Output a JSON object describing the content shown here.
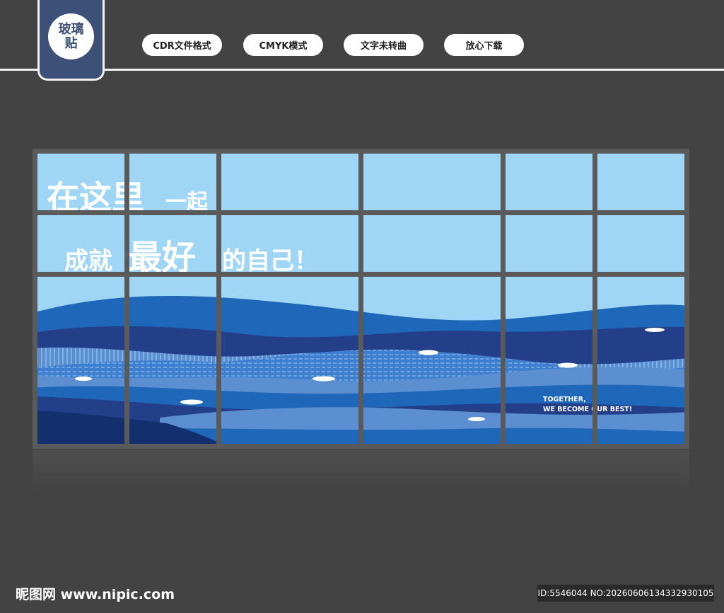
{
  "header": {
    "tag_label": "玻璃贴",
    "pills": [
      "CDR文件格式",
      "CMYK模式",
      "文字未转曲",
      "放心下载"
    ]
  },
  "artwork": {
    "title_line1_big": "在这里",
    "title_line1_small": "一起",
    "title_line2_a": "成就",
    "title_line2_big": "最好",
    "title_line2_b": "的自己！",
    "slogan_line1": "TOGETHER,",
    "slogan_line2": "WE BECOME  OUR BEST!",
    "colors": {
      "sky": "#9fd6f5",
      "wave_light": "#5b8fd1",
      "wave_mid": "#1f67b9",
      "wave_dark": "#243f8a",
      "wave_deep": "#142f6e",
      "frame": "#5a5a5a"
    }
  },
  "footer": {
    "site": "昵图网 www.nipic.com",
    "id_text": "ID:5546044 NO:20260606134332930105"
  }
}
